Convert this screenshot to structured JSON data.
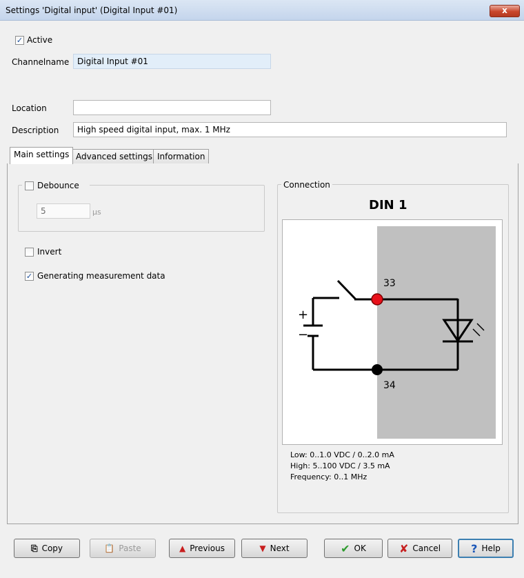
{
  "window": {
    "title": "Settings 'Digital input' (Digital Input #01)",
    "close_label": "x"
  },
  "active": {
    "label": "Active",
    "checked": true
  },
  "fields": {
    "channelname": {
      "label": "Channelname",
      "value": "Digital Input #01"
    },
    "location": {
      "label": "Location",
      "value": ""
    },
    "description": {
      "label": "Description",
      "value": "High speed digital input, max. 1 MHz"
    }
  },
  "tabs": [
    {
      "label": "Main settings",
      "active": true
    },
    {
      "label": "Advanced settings",
      "active": false
    },
    {
      "label": "Information",
      "active": false
    }
  ],
  "main": {
    "debounce": {
      "label": "Debounce",
      "checked": false,
      "value": "5",
      "unit": "µs"
    },
    "invert": {
      "label": "Invert",
      "checked": false
    },
    "generating": {
      "label": "Generating measurement data",
      "checked": true
    }
  },
  "connection": {
    "group_label": "Connection",
    "title": "DIN 1",
    "pin_top": "33",
    "pin_bottom": "34",
    "plus": "+",
    "minus": "−",
    "specs": [
      "Low: 0..1.0 VDC / 0..2.0 mA",
      "High: 5..100 VDC / 3.5 mA",
      "Frequency: 0..1 MHz"
    ]
  },
  "buttons": {
    "copy": "Copy",
    "paste": "Paste",
    "previous": "Previous",
    "next": "Next",
    "ok": "OK",
    "cancel": "Cancel",
    "help": "Help"
  },
  "colors": {
    "accent_pin": "#e8101a",
    "ok_green": "#2e9b2e",
    "cancel_red": "#c62020",
    "arrow_red": "#c81e1e"
  }
}
